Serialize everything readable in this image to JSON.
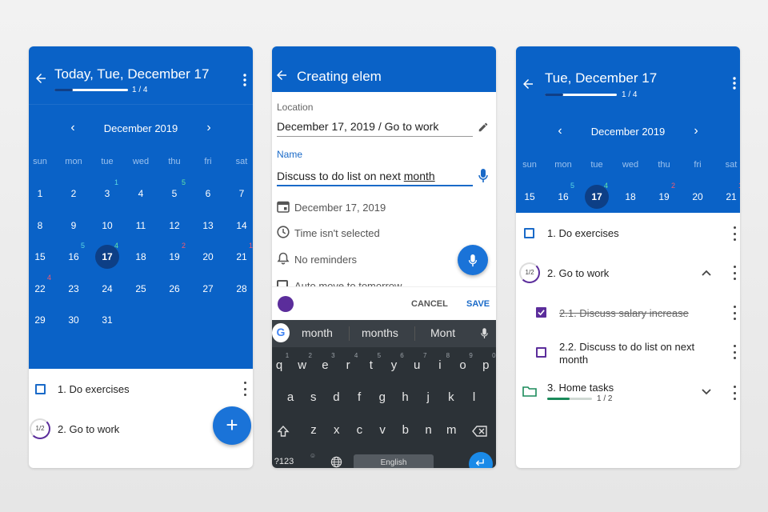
{
  "colors": {
    "primary": "#0a62c7",
    "today": "#0d3f86",
    "accent_purple": "#5b2d9b",
    "fab": "#1a73d8"
  },
  "screen1": {
    "title": "Today, Tue, December 17",
    "progress": {
      "label": "1 / 4",
      "fraction": 0.25
    },
    "calendar": {
      "month": "December 2019",
      "weekdays": [
        "sun",
        "mon",
        "tue",
        "wed",
        "thu",
        "fri",
        "sat"
      ],
      "weeks": [
        [
          "1",
          "2",
          "3",
          "4",
          "5",
          "6",
          "7"
        ],
        [
          "8",
          "9",
          "10",
          "11",
          "12",
          "13",
          "14"
        ],
        [
          "15",
          "16",
          "17",
          "18",
          "19",
          "20",
          "21"
        ],
        [
          "22",
          "23",
          "24",
          "25",
          "26",
          "27",
          "28"
        ],
        [
          "29",
          "30",
          "31",
          "",
          "",
          "",
          ""
        ]
      ],
      "badges": [
        {
          "day": "3",
          "count": "1",
          "color": "cyan"
        },
        {
          "day": "5",
          "count": "5",
          "color": "green"
        },
        {
          "day": "16",
          "count": "5",
          "color": "cyan"
        },
        {
          "day": "17",
          "count": "4",
          "color": "green"
        },
        {
          "day": "19",
          "count": "2",
          "color": "red"
        },
        {
          "day": "21",
          "count": "1",
          "color": "red"
        },
        {
          "day": "22",
          "count": "4",
          "color": "red"
        }
      ]
    },
    "tasks": [
      {
        "label": "1. Do exercises"
      },
      {
        "label": "2. Go to work",
        "progress": "1/2"
      }
    ],
    "fab_label": "+"
  },
  "screen2": {
    "title": "Creating elem",
    "location_label": "Location",
    "location_value": "December 17, 2019 / Go to work",
    "name_label": "Name",
    "name_value": "Discuss to do list on next ",
    "name_value_underlined": "month",
    "date": "December 17, 2019",
    "time": "Time isn't selected",
    "reminders": "No reminders",
    "auto_move": "Auto move to tomorrow",
    "cancel": "CANCEL",
    "save": "SAVE",
    "suggestions": [
      "month",
      "months",
      "Mont"
    ],
    "keys_row1": [
      "q",
      "w",
      "e",
      "r",
      "t",
      "y",
      "u",
      "i",
      "o",
      "p"
    ],
    "keys_row1_sub": [
      "1",
      "2",
      "3",
      "4",
      "5",
      "6",
      "7",
      "8",
      "9",
      "0"
    ],
    "keys_row2": [
      "a",
      "s",
      "d",
      "f",
      "g",
      "h",
      "j",
      "k",
      "l"
    ],
    "keys_row3": [
      "z",
      "x",
      "c",
      "v",
      "b",
      "n",
      "m"
    ],
    "sym_key": "?123",
    "space_label": "English"
  },
  "screen3": {
    "title": "Tue, December 17",
    "progress": {
      "label": "1 / 4",
      "fraction": 0.25
    },
    "month": "December 2019",
    "weekdays": [
      "sun",
      "mon",
      "tue",
      "wed",
      "thu",
      "fri",
      "sat"
    ],
    "week": [
      "15",
      "16",
      "17",
      "18",
      "19",
      "20",
      "21"
    ],
    "badges": [
      {
        "day": "16",
        "count": "5",
        "color": "cyan"
      },
      {
        "day": "17",
        "count": "4",
        "color": "green"
      },
      {
        "day": "19",
        "count": "2",
        "color": "red"
      },
      {
        "day": "21",
        "count": "1",
        "color": "red"
      }
    ],
    "tasks": [
      {
        "label": "1. Do exercises"
      },
      {
        "label": "2. Go to work",
        "progress": "1/2"
      },
      {
        "label": "2.1. Discuss salary increase",
        "done": true
      },
      {
        "label": "2.2. Discuss to do list on next month"
      },
      {
        "label": "3. Home tasks",
        "progress_label": "1 / 2",
        "fraction": 0.5
      }
    ]
  }
}
